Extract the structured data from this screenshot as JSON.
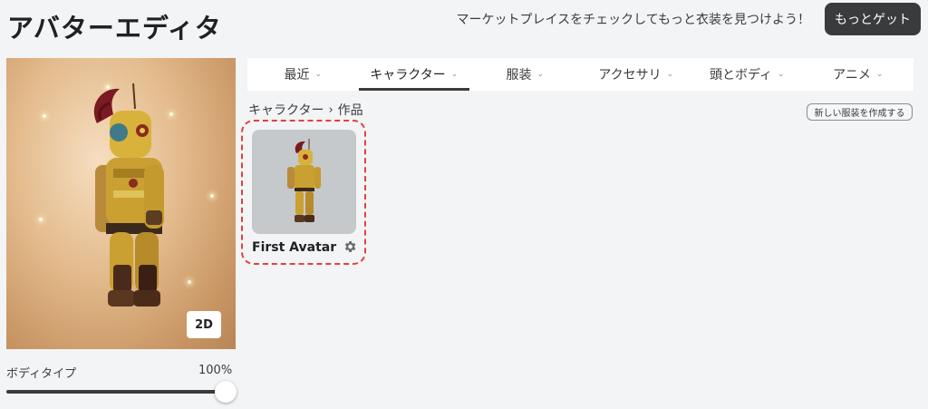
{
  "header": {
    "title": "アバターエディタ",
    "promo_text": "マーケットプレイスをチェックしてもっと衣装を見つけよう！",
    "get_more_label": "もっとゲット"
  },
  "preview": {
    "toggle_label": "2D"
  },
  "body_type": {
    "label": "ボディタイプ",
    "value_text": "100%",
    "value": 100
  },
  "tabs": [
    {
      "label": "最近",
      "active": false
    },
    {
      "label": "キャラクター",
      "active": true
    },
    {
      "label": "服装",
      "active": false
    },
    {
      "label": "アクセサリ",
      "active": false
    },
    {
      "label": "頭とボディ",
      "active": false
    },
    {
      "label": "アニメ",
      "active": false
    }
  ],
  "breadcrumb": {
    "parent": "キャラクター",
    "separator": "›",
    "current": "作品"
  },
  "create_outfit_label": "新しい服装を作成する",
  "outfits": [
    {
      "name": "First Avatar",
      "icon": "gear-icon"
    }
  ],
  "colors": {
    "accent_dark": "#393b3d",
    "highlight": "#e2413f",
    "background": "#f2f4f5"
  }
}
